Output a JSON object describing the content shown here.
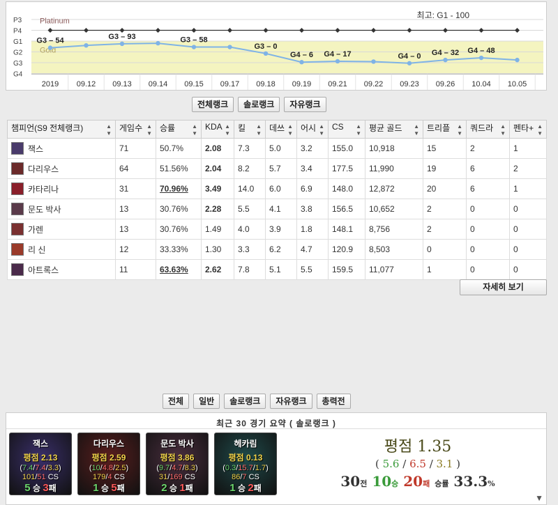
{
  "chart_data": {
    "type": "line",
    "max_label": "최고: G1 - 100",
    "tier_labels": [
      "P3",
      "P4",
      "G1",
      "G2",
      "G3",
      "G4"
    ],
    "band_labels": [
      "Platinum",
      "Gold"
    ],
    "categories": [
      "2019",
      "09.12",
      "09.13",
      "09.14",
      "09.15",
      "09.17",
      "09.18",
      "09.19",
      "09.21",
      "09.22",
      "09.23",
      "09.26",
      "10.04",
      "10.05"
    ],
    "series": [
      {
        "values": [
          4,
          4,
          4,
          4,
          4,
          4,
          4,
          4,
          4,
          4,
          4,
          4,
          4,
          4
        ],
        "color": "#333333"
      },
      {
        "values": [
          2.38,
          2.6,
          2.75,
          2.8,
          2.45,
          2.45,
          1.85,
          1.05,
          1.13,
          1.1,
          0.95,
          1.25,
          1.45,
          1.25
        ],
        "color": "#7fb3e6"
      }
    ],
    "point_labels": [
      "G3 – 54",
      "",
      "G3 – 93",
      "",
      "G3 – 58",
      "",
      "G3 – 0",
      "G4 – 6",
      "G4 – 17",
      "",
      "G4 – 0",
      "G4 – 32",
      "G4 – 48",
      ""
    ],
    "gold_band_color": "#f4f4c0"
  },
  "rank_tabs": [
    "전체랭크",
    "솔로랭크",
    "자유랭크"
  ],
  "table": {
    "headers": [
      "챔피언(S9 전체랭크)",
      "게임수",
      "승률",
      "KDA",
      "킬",
      "데쓰",
      "어시",
      "CS",
      "평균 골드",
      "트리플",
      "쿼드라",
      "펜타+"
    ],
    "rows": [
      {
        "champ": "잭스",
        "icon": "#4a3b6b",
        "games": "71",
        "winrate": "50.7%",
        "wr_style": "green",
        "kda": "2.08",
        "kda_style": "green",
        "kills": "7.3",
        "deaths": "5.0",
        "assists": "3.2",
        "cs": "155.0",
        "gold": "10,918",
        "triple": "15",
        "quadra": "2",
        "penta": "1"
      },
      {
        "champ": "다리우스",
        "icon": "#6b2a2a",
        "games": "64",
        "winrate": "51.56%",
        "wr_style": "green",
        "kda": "2.04",
        "kda_style": "green",
        "kills": "8.2",
        "deaths": "5.7",
        "assists": "3.4",
        "cs": "177.5",
        "gold": "11,990",
        "triple": "19",
        "quadra": "6",
        "penta": "2"
      },
      {
        "champ": "카타리나",
        "icon": "#8a1f2a",
        "games": "31",
        "winrate": "70.96%",
        "wr_style": "red",
        "kda": "3.49",
        "kda_style": "blue",
        "kills": "14.0",
        "deaths": "6.0",
        "assists": "6.9",
        "cs": "148.0",
        "gold": "12,872",
        "triple": "20",
        "quadra": "6",
        "penta": "1"
      },
      {
        "champ": "문도 박사",
        "icon": "#5a3a4a",
        "games": "13",
        "winrate": "30.76%",
        "wr_style": "normal",
        "kda": "2.28",
        "kda_style": "green",
        "kills": "5.5",
        "deaths": "4.1",
        "assists": "3.8",
        "cs": "156.5",
        "gold": "10,652",
        "triple": "2",
        "quadra": "0",
        "penta": "0"
      },
      {
        "champ": "가렌",
        "icon": "#7a3030",
        "games": "13",
        "winrate": "30.76%",
        "wr_style": "normal",
        "kda": "1.49",
        "kda_style": "normal",
        "kills": "4.0",
        "deaths": "3.9",
        "assists": "1.8",
        "cs": "148.1",
        "gold": "8,756",
        "triple": "2",
        "quadra": "0",
        "penta": "0"
      },
      {
        "champ": "리 신",
        "icon": "#9a3a2a",
        "games": "12",
        "winrate": "33.33%",
        "wr_style": "normal",
        "kda": "1.30",
        "kda_style": "normal",
        "kills": "3.3",
        "deaths": "6.2",
        "assists": "4.7",
        "cs": "120.9",
        "gold": "8,503",
        "triple": "0",
        "quadra": "0",
        "penta": "0"
      },
      {
        "champ": "아트록스",
        "icon": "#4a2a4a",
        "games": "11",
        "winrate": "63.63%",
        "wr_style": "red",
        "kda": "2.62",
        "kda_style": "green",
        "kills": "7.8",
        "deaths": "5.1",
        "assists": "5.5",
        "cs": "159.5",
        "gold": "11,077",
        "triple": "1",
        "quadra": "0",
        "penta": "0"
      }
    ]
  },
  "detail_button": "자세히 보기",
  "match_tabs": [
    "전체",
    "일반",
    "솔로랭크",
    "자유랭크",
    "총력전"
  ],
  "summary": {
    "title": "최근 30 경기 요약 ( 솔로랭크 )",
    "cards": [
      {
        "name": "잭스",
        "rating": "평점 2.13",
        "k": "7.4",
        "d": "7.4",
        "a": "3.3",
        "cs_val": "101",
        "cs_games": "51",
        "cs_label": "CS",
        "wins": "5",
        "win_label": "승",
        "losses": "3",
        "loss_label": "패",
        "bg": "#3a2f6a"
      },
      {
        "name": "다리우스",
        "rating": "평점 2.59",
        "k": "10",
        "d": "4.8",
        "a": "2.5",
        "cs_val": "179",
        "cs_games": "4",
        "cs_label": "CS",
        "wins": "1",
        "win_label": "승",
        "losses": "5",
        "loss_label": "패",
        "bg": "#5a1e1e"
      },
      {
        "name": "문도 박사",
        "rating": "평점 3.86",
        "k": "9.7",
        "d": "4.7",
        "a": "8.3",
        "cs_val": "31",
        "cs_games": "169",
        "cs_label": "CS",
        "wins": "2",
        "win_label": "승",
        "losses": "1",
        "loss_label": "패",
        "bg": "#4a2e3e"
      },
      {
        "name": "헤카림",
        "rating": "평점 0.13",
        "k": "0.3",
        "d": "15.7",
        "a": "1.7",
        "cs_val": "86",
        "cs_games": "7",
        "cs_label": "CS",
        "wins": "1",
        "win_label": "승",
        "losses": "2",
        "loss_label": "패",
        "bg": "#1f4a4a"
      }
    ],
    "overall": {
      "rating": "평점 1.35",
      "k": "5.6",
      "d": "6.5",
      "a": "3.1",
      "games": "30",
      "games_label": "전",
      "wins": "10",
      "wins_label": "승",
      "losses": "20",
      "losses_label": "패",
      "winrate_label": "승률",
      "winrate": "33.3",
      "pct": "%"
    }
  }
}
